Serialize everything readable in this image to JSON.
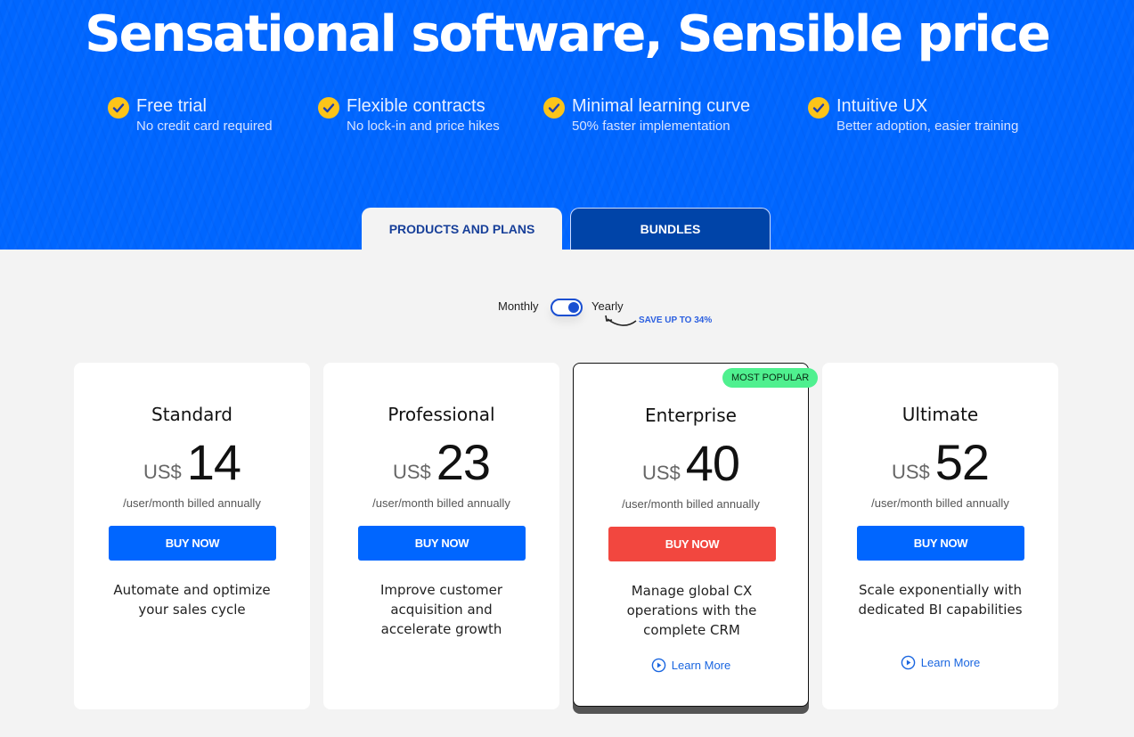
{
  "hero": {
    "title": "Sensational software, Sensible price",
    "features": [
      {
        "icon": "check-circle-icon",
        "title": "Free trial",
        "subtitle": "No credit card required"
      },
      {
        "icon": "check-circle-icon",
        "title": "Flexible contracts",
        "subtitle": "No lock-in and price hikes"
      },
      {
        "icon": "check-circle-icon",
        "title": "Minimal learning curve",
        "subtitle": "50% faster implementation"
      },
      {
        "icon": "check-circle-icon",
        "title": "Intuitive UX",
        "subtitle": "Better adoption, easier training"
      }
    ]
  },
  "tabs": [
    {
      "label": "PRODUCTS AND PLANS",
      "active": true
    },
    {
      "label": "BUNDLES",
      "active": false
    }
  ],
  "billing": {
    "monthly_label": "Monthly",
    "yearly_label": "Yearly",
    "selected": "Yearly",
    "save_text": "SAVE UP TO 34%"
  },
  "plans": [
    {
      "name": "Standard",
      "currency": "US$",
      "price": "14",
      "billed": "/user/month billed annually",
      "button": "BUY NOW",
      "description": "Automate and optimize your sales cycle",
      "learn_more": null,
      "badge": null
    },
    {
      "name": "Professional",
      "currency": "US$",
      "price": "23",
      "billed": "/user/month billed annually",
      "button": "BUY NOW",
      "description": "Improve customer acquisition and accelerate growth",
      "learn_more": null,
      "badge": null
    },
    {
      "name": "Enterprise",
      "currency": "US$",
      "price": "40",
      "billed": "/user/month billed annually",
      "button": "BUY NOW",
      "description": "Manage global CX operations with the complete CRM",
      "learn_more": "Learn More",
      "badge": "MOST POPULAR"
    },
    {
      "name": "Ultimate",
      "currency": "US$",
      "price": "52",
      "billed": "/user/month billed annually",
      "button": "BUY NOW",
      "description": "Scale exponentially with dedicated BI capabilities",
      "learn_more": "Learn More",
      "badge": null
    }
  ],
  "colors": {
    "hero_blue": "#0066ff",
    "check_yellow": "#fcc419",
    "buy_blue": "#0066ff",
    "buy_red": "#f2473f",
    "badge_green": "#4ff08f",
    "tab_dark": "#0044a8",
    "link_blue": "#1a66e0"
  }
}
